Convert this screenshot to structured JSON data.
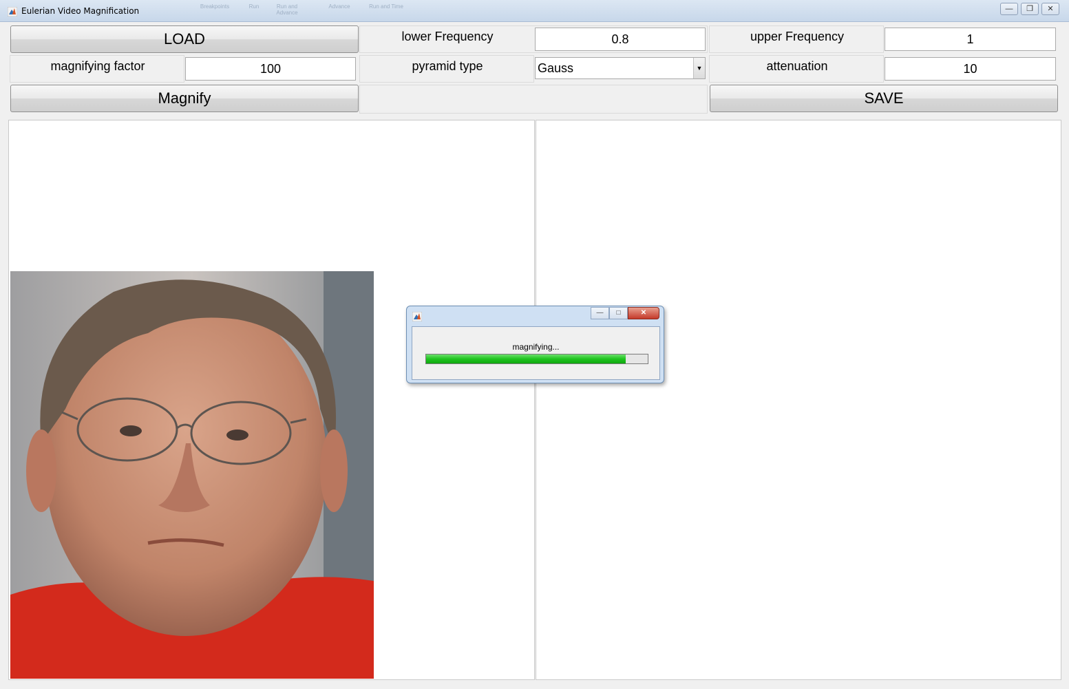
{
  "window": {
    "title": "Eulerian Video Magnification",
    "ghost_toolbar": [
      "Breakpoints",
      "Run",
      "Run and Advance",
      "Advance",
      "Run and Time"
    ],
    "controls": [
      "minimize",
      "restore",
      "close"
    ]
  },
  "toolbar": {
    "load_label": "LOAD",
    "magnify_label": "Magnify",
    "save_label": "SAVE"
  },
  "params": {
    "lower_frequency": {
      "label": "lower Frequency",
      "value": "0.8"
    },
    "upper_frequency": {
      "label": "upper Frequency",
      "value": "1"
    },
    "magnifying_factor": {
      "label": "magnifying factor",
      "value": "100"
    },
    "pyramid_type": {
      "label": "pyramid type",
      "value": "Gauss"
    },
    "attenuation": {
      "label": "attenuation",
      "value": "10"
    }
  },
  "progress_dialog": {
    "message": "magnifying...",
    "progress": 0.9
  },
  "colors": {
    "window_bg": "#f0f0f0",
    "progress_fill": "#1fc41f",
    "close_button": "#c5392a"
  }
}
